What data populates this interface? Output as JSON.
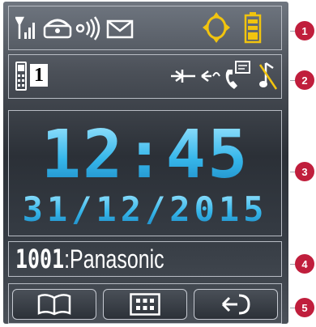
{
  "status_bar": {
    "icons": [
      "signal-strength-icon",
      "intercom-icon",
      "ringer-icon",
      "message-icon",
      "navigation-key-icon",
      "battery-icon"
    ]
  },
  "status_bar_2": {
    "line_icon": "handset-icon",
    "line_number": "1",
    "icons": [
      "call-diversion-icon",
      "call-waiting-icon",
      "missed-call-icon",
      "silent-mode-icon"
    ]
  },
  "idle_screen": {
    "time": "12:45",
    "date": "31/12/2015"
  },
  "handset_name": {
    "extension": "1001",
    "separator": ":",
    "name": "Panasonic"
  },
  "softkeys": [
    "phonebook-icon",
    "menu-icon",
    "back-icon"
  ],
  "callouts": [
    "1",
    "2",
    "3",
    "4",
    "5"
  ],
  "colors": {
    "clock_blue": "#36b6ea",
    "panel_border": "#b8bcc4",
    "badge": "#c01e3c",
    "icon": "#ffffff"
  }
}
